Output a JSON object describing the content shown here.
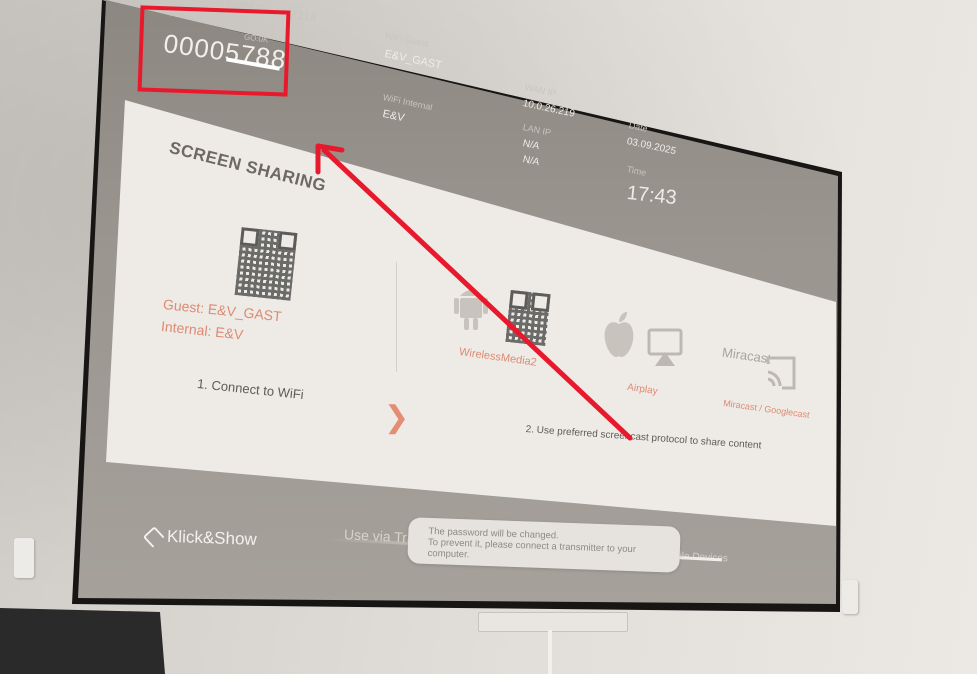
{
  "tv": {
    "room_name": "EoW-EuV-HZ114",
    "pin_label": "PIN",
    "pin_label_2": "GO:0K",
    "pin_code": "00005788",
    "wifi_guest_label": "WiFi Guest",
    "wifi_guest_value": "E&V_GAST",
    "wifi_internal_label": "WiFi Internal",
    "wifi_internal_value": "E&V",
    "wan_ip_label": "WAN IP",
    "wan_ip_value": "10.0.26.219",
    "lan_ip_label": "LAN IP",
    "lan_ip_value_1": "N/A",
    "lan_ip_value_2": "N/A",
    "date_label": "Date",
    "date_value": "03.09.2025",
    "time_label": "Time",
    "time_value": "17:43"
  },
  "screen_sharing": {
    "heading": "SCREEN SHARING",
    "guest_line": "Guest: E&V_GAST",
    "internal_line": "Internal: E&V",
    "step1": "1. Connect to WiFi",
    "step2": "2. Use preferred screencast protocol to share content",
    "wirelessmedia": "WirelessMedia2",
    "airplay": "Airplay",
    "miracast_logo": "Miracast",
    "miracast_googlecast": "Miracast / Googlecast",
    "chevron": "❯"
  },
  "footer": {
    "logo": "Klick&Show",
    "use_via": "Use via Tra",
    "mobile_devices": "bile Devices"
  },
  "popup": {
    "line1": "The password will be changed.",
    "line2": "To prevent it, please connect a transmitter to your computer."
  },
  "colors": {
    "annotation_red": "#e8192c",
    "accent_salmon": "#dd8a72"
  },
  "icons": [
    "android-icon",
    "apple-icon",
    "airplay-icon",
    "cast-icon",
    "qr-code-icon"
  ]
}
